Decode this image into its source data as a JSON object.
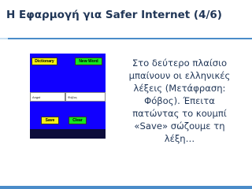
{
  "slide": {
    "title": "Η Εφαρμογή για Safer Internet (4/6)"
  },
  "app": {
    "dictionary_label": "Dictionary",
    "new_word_label": "New Word",
    "english_field_value": "Angst",
    "greek_field_value": "Φόβος",
    "save_label": "Save",
    "clear_label": "Clear"
  },
  "body": {
    "lines": [
      "Στο δεύτερο πλαίσιο",
      "μπαίνουν οι ελληνικές",
      "λέξεις (Μετάφραση:",
      "Φόβος). Έπειτα",
      "πατώντας το κουμπί",
      "«Save» σώζουμε τη",
      "λέξη…"
    ]
  },
  "colors": {
    "title_text": "#1f3556",
    "rule": "#4a8cc9",
    "app_background": "#1100ff",
    "yellow_button": "#f5ef14",
    "green_button": "#14e81f"
  }
}
